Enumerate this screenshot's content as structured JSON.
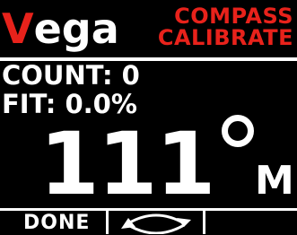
{
  "brand": {
    "initial": "V",
    "rest": "ega"
  },
  "mode": {
    "line1": "COMPASS",
    "line2": "CALIBRATE"
  },
  "stats": {
    "count": "COUNT: 0",
    "fit": "FIT: 0.0%"
  },
  "heading": {
    "value": "111",
    "unit": "M"
  },
  "softkeys": {
    "done_label": "DONE"
  },
  "colors": {
    "accent": "#e8221b",
    "text": "#ffffff",
    "background": "#000000"
  },
  "icons": {
    "rotate": "rotate-arrows-icon",
    "degree": "degree-icon"
  }
}
